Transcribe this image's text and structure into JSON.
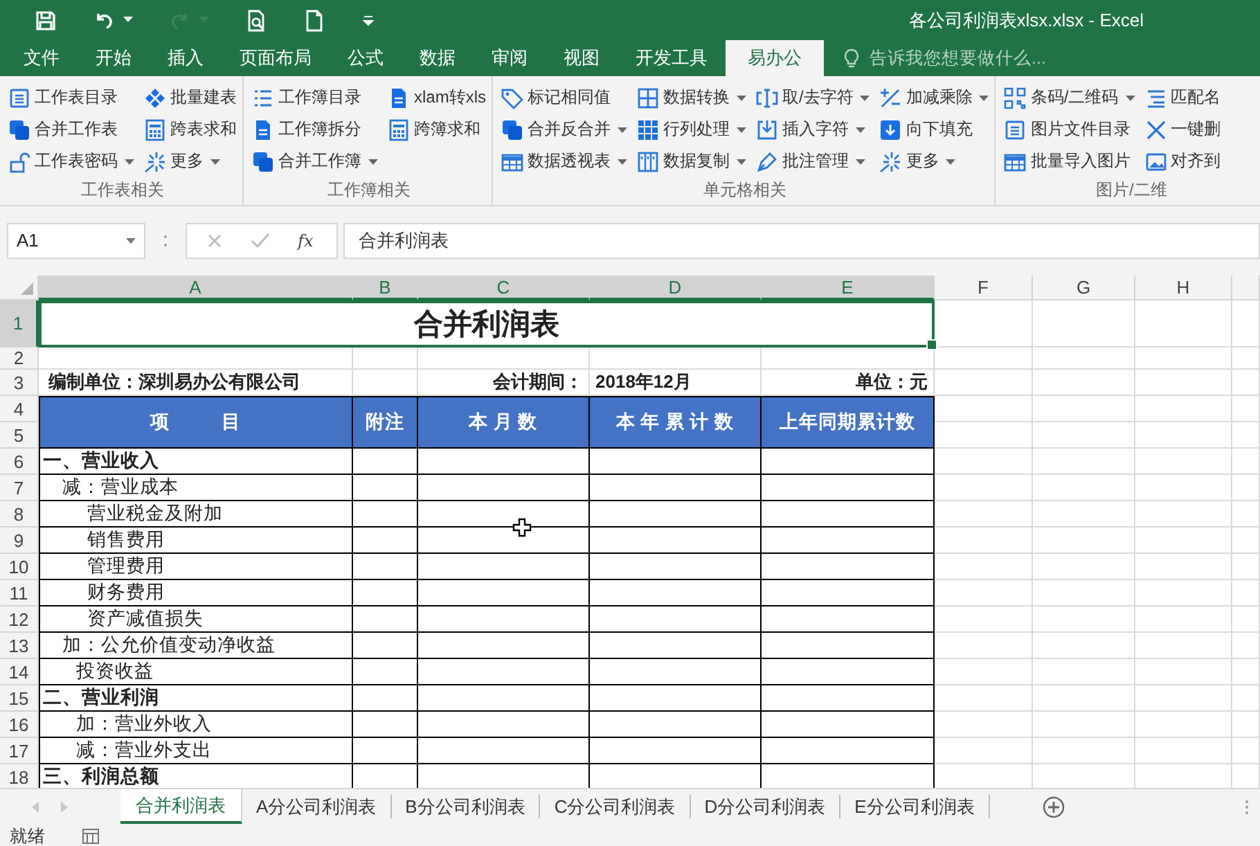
{
  "window": {
    "title": "各公司利润表xlsx.xlsx - Excel"
  },
  "quick_access": [
    {
      "kind": "save"
    },
    {
      "kind": "undo",
      "disabled": false
    },
    {
      "kind": "redo",
      "disabled": true
    },
    {
      "kind": "preview"
    },
    {
      "kind": "new"
    },
    {
      "kind": "customize"
    }
  ],
  "tabs": [
    {
      "label": "文件",
      "selected": false
    },
    {
      "label": "开始",
      "selected": false
    },
    {
      "label": "插入",
      "selected": false
    },
    {
      "label": "页面布局",
      "selected": false
    },
    {
      "label": "公式",
      "selected": false
    },
    {
      "label": "数据",
      "selected": false
    },
    {
      "label": "审阅",
      "selected": false
    },
    {
      "label": "视图",
      "selected": false
    },
    {
      "label": "开发工具",
      "selected": false
    },
    {
      "label": "易办公",
      "selected": true
    }
  ],
  "tell_me": {
    "placeholder": "告诉我您想要做什么..."
  },
  "ribbon_groups": [
    {
      "label": "工作表相关",
      "columns": [
        [
          {
            "label": "工作表目录",
            "dropdown": false
          },
          {
            "label": "合并工作表",
            "dropdown": false
          },
          {
            "label": "工作表密码",
            "dropdown": true
          }
        ],
        [
          {
            "label": "批量建表",
            "dropdown": false
          },
          {
            "label": "跨表求和",
            "dropdown": false
          },
          {
            "label": "更多",
            "dropdown": true
          }
        ]
      ]
    },
    {
      "label": "工作簿相关",
      "columns": [
        [
          {
            "label": "工作簿目录",
            "dropdown": false
          },
          {
            "label": "工作簿拆分",
            "dropdown": false
          },
          {
            "label": "合并工作簿",
            "dropdown": true
          }
        ],
        [
          {
            "label": "xlam转xls",
            "dropdown": false
          },
          {
            "label": "跨簿求和",
            "dropdown": false
          }
        ]
      ]
    },
    {
      "label": "单元格相关",
      "columns": [
        [
          {
            "label": "标记相同值",
            "dropdown": false
          },
          {
            "label": "合并反合并",
            "dropdown": true
          },
          {
            "label": "数据透视表",
            "dropdown": true
          }
        ],
        [
          {
            "label": "数据转换",
            "dropdown": true
          },
          {
            "label": "行列处理",
            "dropdown": true
          },
          {
            "label": "数据复制",
            "dropdown": true
          }
        ],
        [
          {
            "label": "取/去字符",
            "dropdown": true
          },
          {
            "label": "插入字符",
            "dropdown": true
          },
          {
            "label": "批注管理",
            "dropdown": true
          }
        ],
        [
          {
            "label": "加减乘除",
            "dropdown": true
          },
          {
            "label": "向下填充",
            "dropdown": false
          },
          {
            "label": "更多",
            "dropdown": true
          }
        ]
      ]
    },
    {
      "label": "图片/二维",
      "columns": [
        [
          {
            "label": "条码/二维码",
            "dropdown": true
          },
          {
            "label": "图片文件目录",
            "dropdown": false
          },
          {
            "label": "批量导入图片",
            "dropdown": false
          }
        ],
        [
          {
            "label": "匹配名"
          },
          {
            "label": "一键删"
          },
          {
            "label": "对齐到"
          }
        ]
      ]
    }
  ],
  "formula_bar": {
    "name_box": "A1",
    "function_label": "fx",
    "value": "合并利润表"
  },
  "sheet": {
    "columns": [
      {
        "letter": "A",
        "selected": true
      },
      {
        "letter": "B",
        "selected": true
      },
      {
        "letter": "C",
        "selected": true
      },
      {
        "letter": "D",
        "selected": true
      },
      {
        "letter": "E",
        "selected": true
      },
      {
        "letter": "F",
        "selected": false
      },
      {
        "letter": "G",
        "selected": false
      },
      {
        "letter": "H",
        "selected": false
      }
    ],
    "title_row": {
      "row": "1",
      "text": "合并利润表",
      "selected": true
    },
    "blank_row": {
      "row": "2"
    },
    "info_row": {
      "row": "3",
      "unit": "编制单位：深圳易办公有限公司",
      "period_label": "会计期间：",
      "period": "2018年12月",
      "currency": "单位：元"
    },
    "header": {
      "rows": [
        "4",
        "5"
      ],
      "cells": [
        "项          目",
        "附注",
        "本 月 数",
        "本 年 累 计 数",
        "上年同期累计数"
      ]
    },
    "items": [
      {
        "row": "6",
        "label": "一、营业收入",
        "kind": "section"
      },
      {
        "row": "7",
        "label": "减：营业成本",
        "kind": "adjust"
      },
      {
        "row": "8",
        "label": "营业税金及附加",
        "kind": "detail"
      },
      {
        "row": "9",
        "label": "销售费用",
        "kind": "detail"
      },
      {
        "row": "10",
        "label": "管理费用",
        "kind": "detail"
      },
      {
        "row": "11",
        "label": "财务费用",
        "kind": "detail"
      },
      {
        "row": "12",
        "label": "资产减值损失",
        "kind": "detail"
      },
      {
        "row": "13",
        "label": "加：公允价值变动净收益",
        "kind": "adjust"
      },
      {
        "row": "14",
        "label": "投资收益",
        "kind": "item"
      },
      {
        "row": "15",
        "label": "二、营业利润",
        "kind": "section"
      },
      {
        "row": "16",
        "label": "加：营业外收入",
        "kind": "item"
      },
      {
        "row": "17",
        "label": "减：营业外支出",
        "kind": "item"
      },
      {
        "row": "18",
        "label": "三、利润总额",
        "kind": "section"
      }
    ]
  },
  "sheet_tabs": [
    {
      "label": "合并利润表",
      "selected": true
    },
    {
      "label": "A分公司利润表",
      "selected": false
    },
    {
      "label": "B分公司利润表",
      "selected": false
    },
    {
      "label": "C分公司利润表",
      "selected": false
    },
    {
      "label": "D分公司利润表",
      "selected": false
    },
    {
      "label": "E分公司利润表",
      "selected": false
    }
  ],
  "status_bar": {
    "text": "就绪"
  }
}
